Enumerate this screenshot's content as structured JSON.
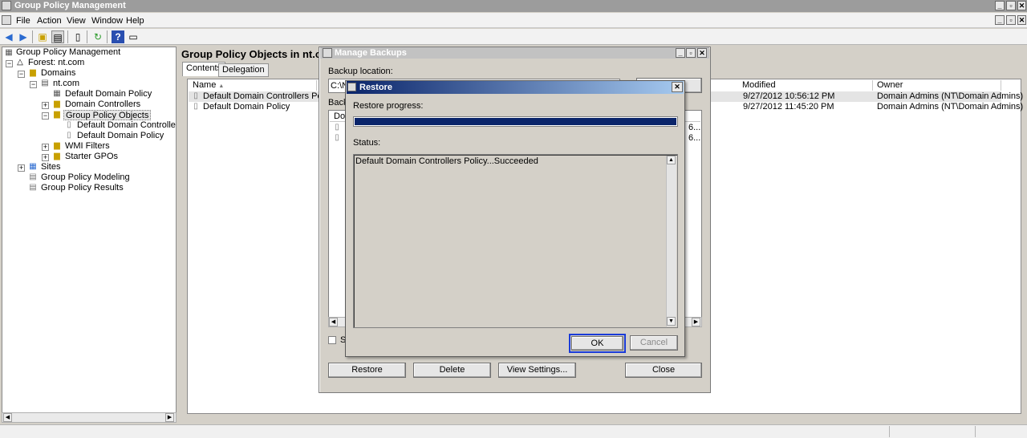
{
  "window": {
    "title": "Group Policy Management"
  },
  "menu": [
    "File",
    "Action",
    "View",
    "Window",
    "Help"
  ],
  "toolbar": {
    "icons": [
      "back-arrow-icon",
      "forward-arrow-icon",
      "folder-up-icon",
      "console-tree-icon",
      "properties-icon",
      "refresh-icon",
      "help-icon",
      "show-hide-icon"
    ]
  },
  "tree": {
    "root": "Group Policy Management",
    "forest": "Forest: nt.com",
    "domains": "Domains",
    "domain": "nt.com",
    "default_domain_policy": "Default Domain Policy",
    "domain_controllers": "Domain Controllers",
    "gpo": "Group Policy Objects",
    "gpo_children": [
      "Default Domain Controllers Polic",
      "Default Domain Policy"
    ],
    "wmi": "WMI Filters",
    "starter": "Starter GPOs",
    "sites": "Sites",
    "modeling": "Group Policy Modeling",
    "results": "Group Policy Results"
  },
  "panel": {
    "title": "Group Policy Objects in nt.com",
    "tabs": [
      "Contents",
      "Delegation"
    ],
    "columns": {
      "name": "Name",
      "modified": "Modified",
      "owner": "Owner"
    },
    "rows": [
      {
        "name": "Default Domain Controllers Policy",
        "modified": "9/27/2012 10:56:12 PM",
        "owner": "Domain Admins (NT\\Domain Admins)"
      },
      {
        "name": "Default Domain Policy",
        "modified": "9/27/2012 11:45:20 PM",
        "owner": "Domain Admins (NT\\Domain Admins)"
      }
    ]
  },
  "manage": {
    "title": "Manage Backups",
    "backup_location_label": "Backup location:",
    "backup_location_value": "C:\\N",
    "backed_label": "Back",
    "list_header": "Dom",
    "row_tail": [
      "6...",
      "6..."
    ],
    "checkbox_label": "S",
    "buttons": {
      "restore": "Restore",
      "delete": "Delete",
      "view_settings": "View Settings...",
      "close": "Close"
    }
  },
  "restore": {
    "title": "Restore",
    "progress_label": "Restore progress:",
    "progress": 1.0,
    "status_label": "Status:",
    "status_text": "Default Domain Controllers Policy...Succeeded",
    "ok": "OK",
    "cancel": "Cancel"
  }
}
